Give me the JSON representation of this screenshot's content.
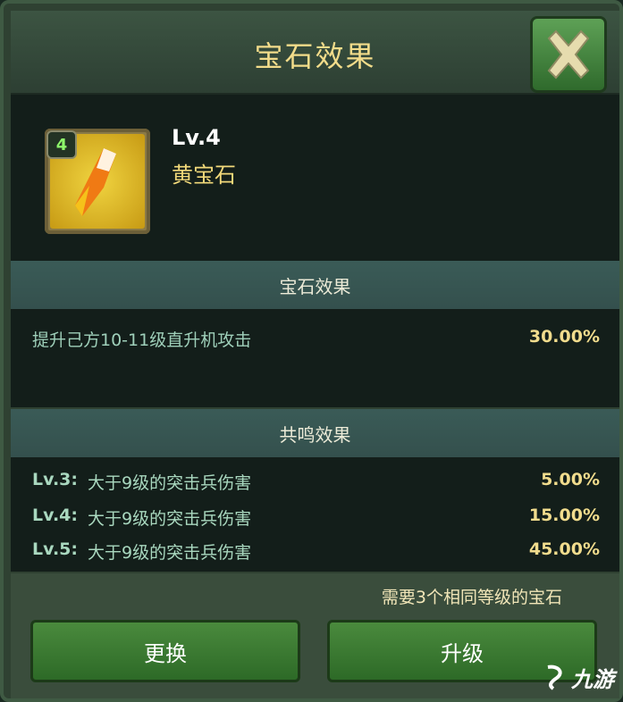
{
  "header": {
    "title": "宝石效果"
  },
  "gem": {
    "badge_level": "4",
    "level_text": "Lv.4",
    "name": "黄宝石"
  },
  "gem_effect": {
    "section_title": "宝石效果",
    "rows": [
      {
        "desc": "提升己方10-11级直升机攻击",
        "value": "30.00%"
      }
    ]
  },
  "resonance": {
    "section_title": "共鸣效果",
    "rows": [
      {
        "level": "Lv.3:",
        "desc": "大于9级的突击兵伤害",
        "value": "5.00%"
      },
      {
        "level": "Lv.4:",
        "desc": "大于9级的突击兵伤害",
        "value": "15.00%"
      },
      {
        "level": "Lv.5:",
        "desc": "大于9级的突击兵伤害",
        "value": "45.00%"
      }
    ]
  },
  "footer": {
    "requirement": "需要3个相同等级的宝石",
    "replace_label": "更换",
    "upgrade_label": "升级"
  },
  "watermark": {
    "text": "九游"
  },
  "colors": {
    "title_gold": "#f2dc8a",
    "button_green": "#3e7f35",
    "close_green": "#4f8f47"
  },
  "icons": {
    "close": "close-x-icon",
    "gem": "yellow-gem-icon",
    "watermark": "jiuyou-logo-icon"
  }
}
